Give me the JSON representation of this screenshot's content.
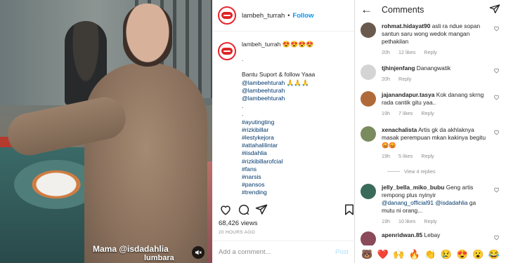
{
  "video": {
    "overlay_line1": "Mama @isdadahlia",
    "overlay_line2": "lumbara"
  },
  "post": {
    "username": "lambeh_turrah",
    "follow_label": "Follow",
    "caption_user": "lambeh_turrah",
    "caption_emojis": "😍😍😍😍",
    "caption_lines": [
      {
        "text": ".",
        "type": "line"
      },
      {
        "text": "",
        "type": "blank"
      },
      {
        "text": "Bantu Suport & follow Yaaa",
        "type": "line"
      },
      {
        "text": "@lambeehturah 🙏🙏🙏",
        "type": "link"
      },
      {
        "text": "@lambeehturah",
        "type": "link"
      },
      {
        "text": "@lambeehturah",
        "type": "link"
      },
      {
        "text": ".",
        "type": "line"
      },
      {
        "text": ".",
        "type": "line"
      },
      {
        "text": "#ayutingting",
        "type": "link"
      },
      {
        "text": "#rizkibillar",
        "type": "link"
      },
      {
        "text": "#lestykejora",
        "type": "link"
      },
      {
        "text": "#attahalilintar",
        "type": "link"
      },
      {
        "text": "#iisdahlia",
        "type": "link"
      },
      {
        "text": "#rizkibillarofcial",
        "type": "link"
      },
      {
        "text": "#fans",
        "type": "link"
      },
      {
        "text": "#narsis",
        "type": "link"
      },
      {
        "text": "#pansos",
        "type": "link"
      },
      {
        "text": "#trending",
        "type": "link"
      }
    ],
    "views": "68,426 views",
    "time_ago": "20 HOURS AGO",
    "add_comment_placeholder": "Add a comment...",
    "post_label": "Post"
  },
  "comments": {
    "title": "Comments",
    "items": [
      {
        "user": "rohmat.hidayat90",
        "text": "asli ra ndue sopan santun saru wong wedok mangan pethakilan",
        "time": "20h",
        "likes": "12 likes",
        "reply": "Reply",
        "avatar_color": "#6a5a4e"
      },
      {
        "user": "tjhinjenfang",
        "text": "Danangwatik",
        "time": "20h",
        "likes": "",
        "reply": "Reply",
        "avatar_color": "#d4d4d4"
      },
      {
        "user": "jajanandapur.tasya",
        "text": "Kok danang skrng rada cantik gitu yaa..",
        "time": "19h",
        "likes": "7 likes",
        "reply": "Reply",
        "avatar_color": "#b06a3a"
      },
      {
        "user": "xenachalista",
        "text": "Artis gk da akhlaknya masak perempuan mkan kakinya begitu😡😡",
        "time": "19h",
        "likes": "5 likes",
        "reply": "Reply",
        "avatar_color": "#7a8b5e"
      },
      {
        "user": "jelly_bella_miko_bubu",
        "text": "Geng artis rempong plus nyinyir",
        "mention1": "@danang_official91",
        "mention2": "@isdadahlia",
        "text_after": "ga mutu ni orang...",
        "time": "19h",
        "likes": "10 likes",
        "reply": "Reply",
        "avatar_color": "#3a6a5a"
      },
      {
        "user": "apenridwan.85",
        "text": "Lebay",
        "time": "",
        "likes": "",
        "reply": "",
        "avatar_color": "#8a4a5a"
      }
    ],
    "view_replies": "View 4 replies",
    "emoji_bar": [
      "🐻",
      "❤️",
      "🙌",
      "🔥",
      "👏",
      "😢",
      "😍",
      "😮",
      "😂"
    ]
  }
}
